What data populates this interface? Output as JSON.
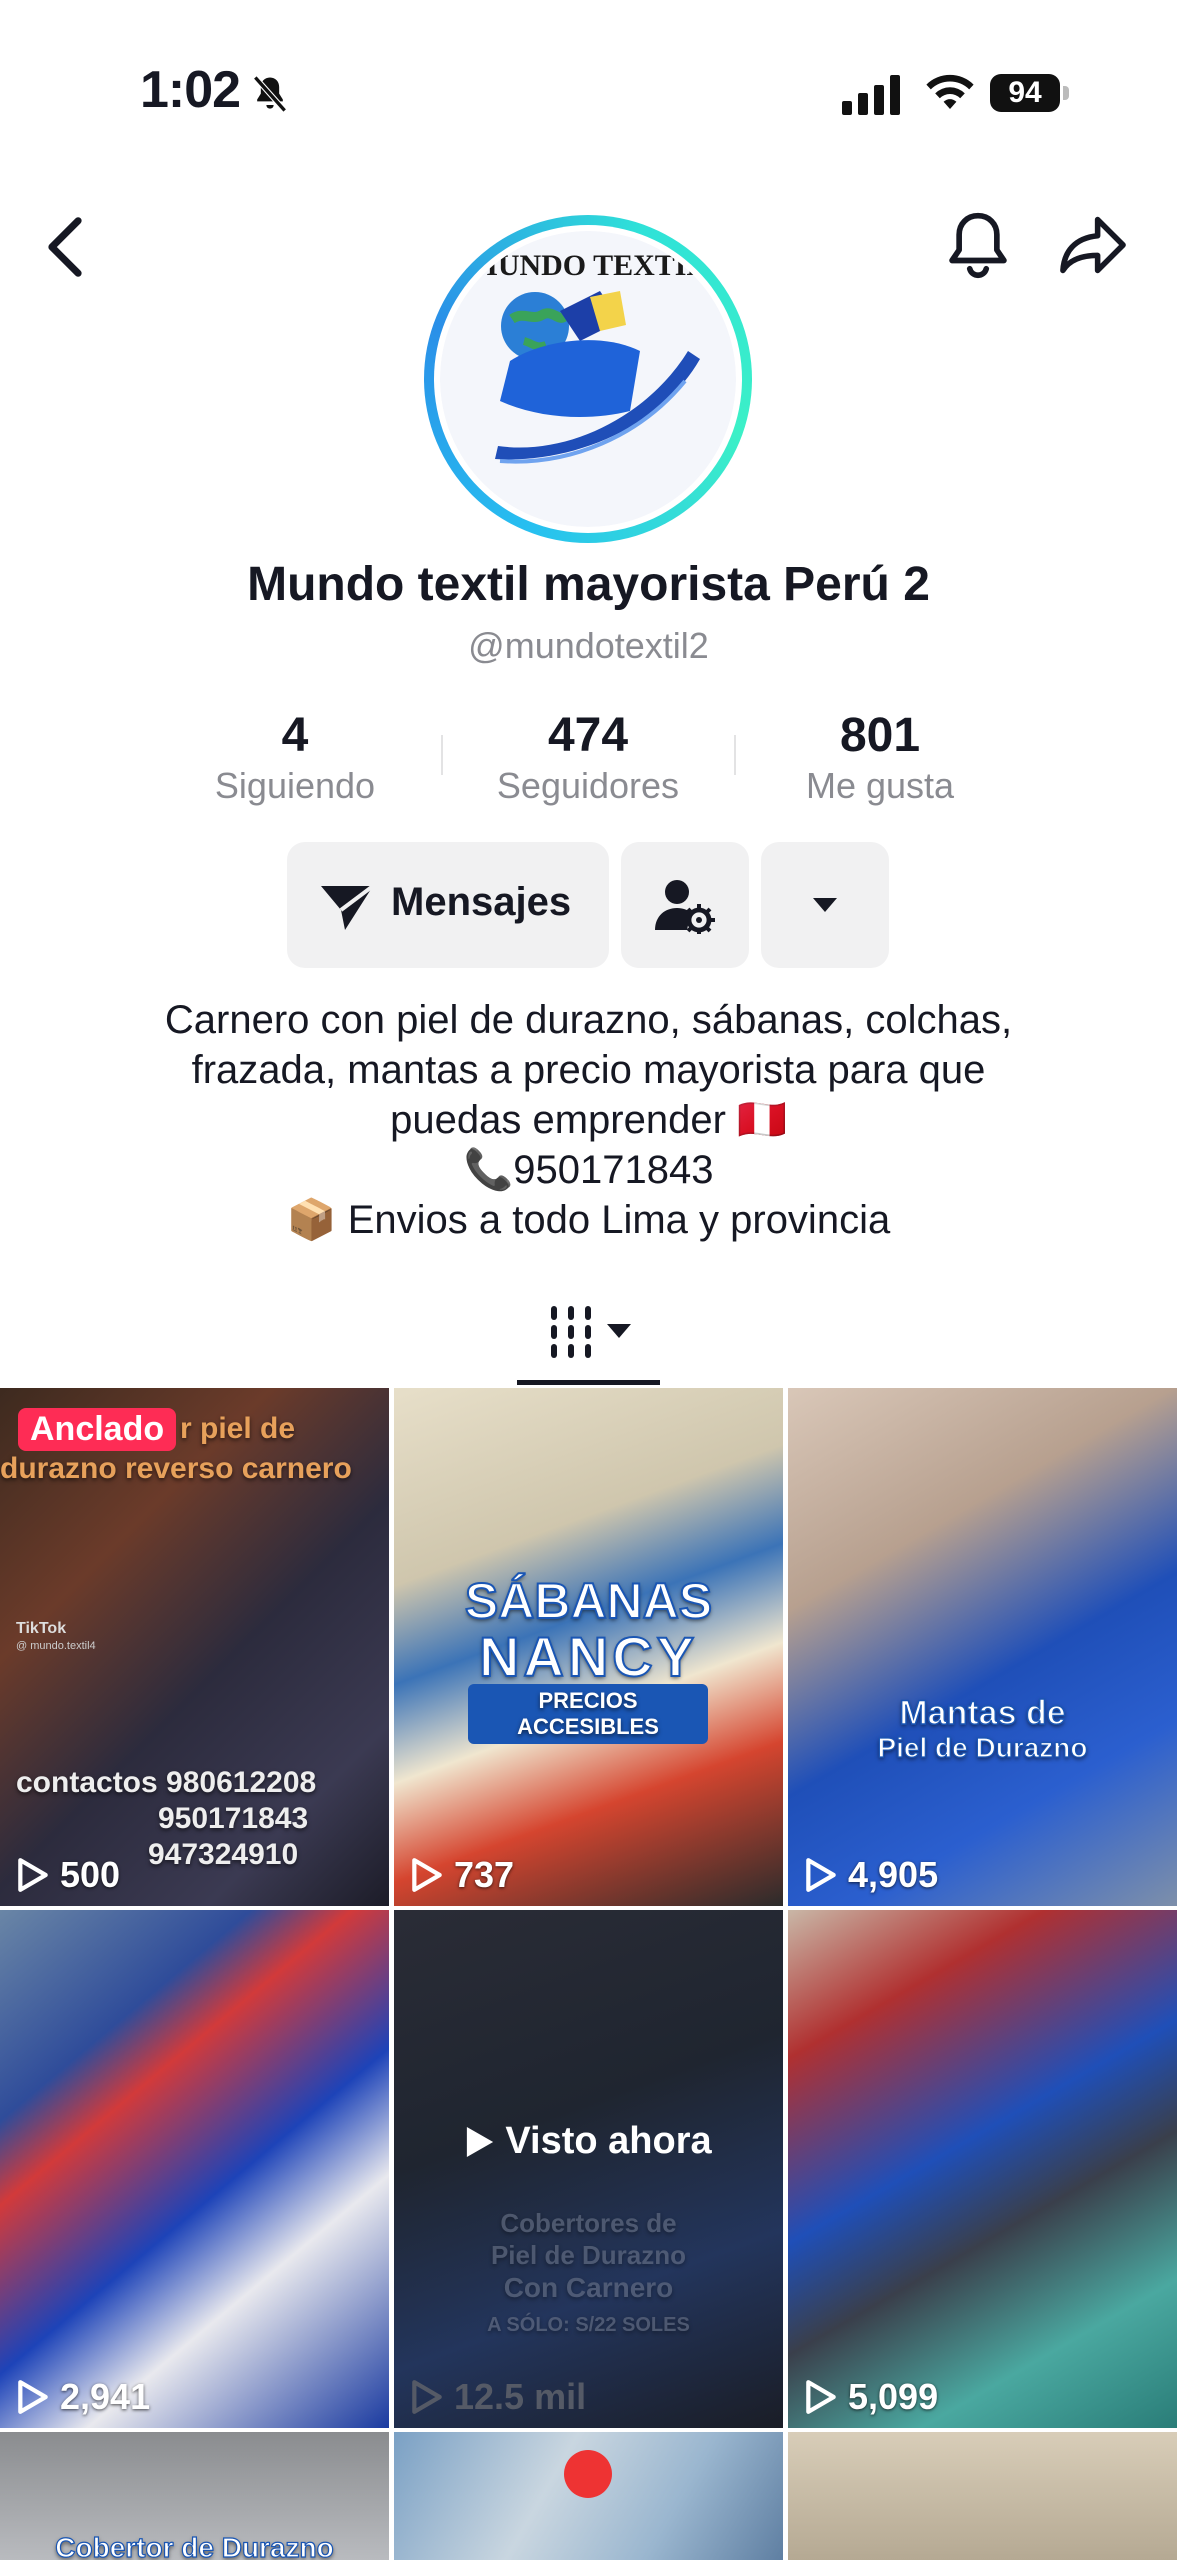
{
  "status_bar": {
    "time": "1:02",
    "battery": "94"
  },
  "profile": {
    "name": "Mundo textil mayorista Perú 2",
    "handle": "@mundotextil2",
    "avatar_text": "MUNDO TEXTIL"
  },
  "stats": [
    {
      "value": "4",
      "label": "Siguiendo"
    },
    {
      "value": "474",
      "label": "Seguidores"
    },
    {
      "value": "801",
      "label": "Me gusta"
    }
  ],
  "actions": {
    "messages_label": "Mensajes"
  },
  "bio": {
    "line1": "Carnero con piel de durazno, sábanas, colchas,",
    "line2": "frazada, mantas a precio mayorista para que",
    "line3": "puedas emprender 🇵🇪",
    "line4": "📞950171843",
    "line5": "📦 Envios a todo Lima y provincia"
  },
  "videos": [
    {
      "views": "500",
      "badge": "Anclado",
      "overlay": [
        "r piel de",
        "durazno reverso carnero"
      ],
      "contacts": [
        "contactos 980612208",
        "950171843",
        "947324910"
      ],
      "watermark": "TikTok",
      "watermark_user": "@ mundo.textil4"
    },
    {
      "views": "737",
      "overlay": [
        "SÁBANAS",
        "NANCY",
        "PRECIOS ACCESIBLES"
      ]
    },
    {
      "views": "4,905",
      "overlay": [
        "Mantas de",
        "Piel de Durazno"
      ]
    },
    {
      "views": "2,941"
    },
    {
      "views": "12.5 mil",
      "now_label": "Visto ahora",
      "overlay": [
        "Cobertores de",
        "Piel de Durazno",
        "Con Carnero",
        "A SÓLO: S/22 SOLES"
      ]
    },
    {
      "views": "5,099"
    },
    {
      "overlay": [
        "Cobertor de Durazno"
      ]
    },
    {},
    {}
  ],
  "colors": {
    "accent": "#fe2c55",
    "text": "#161823",
    "secondary": "#8a8b91",
    "button_bg": "#f1f1f2"
  },
  "icons": [
    "bell-muted-icon",
    "signal-icon",
    "wifi-icon",
    "battery-icon",
    "back-icon",
    "bell-icon",
    "share-icon",
    "send-icon",
    "user-settings-icon",
    "caret-down-icon",
    "grid-icon",
    "play-icon"
  ]
}
